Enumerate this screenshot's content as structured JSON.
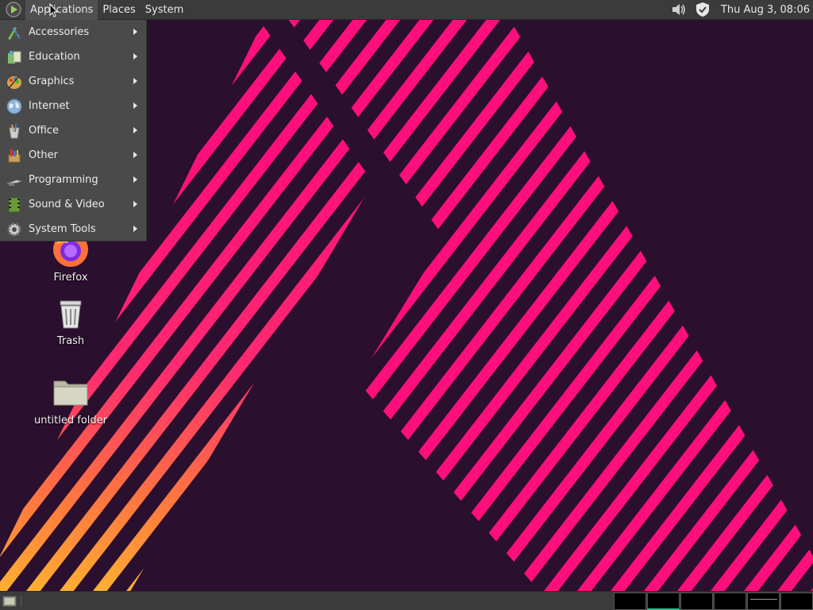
{
  "top_panel": {
    "menus": [
      "Applications",
      "Places",
      "System"
    ],
    "clock": "Thu Aug  3, 08:06",
    "tray": [
      "volume-icon",
      "shield-icon"
    ]
  },
  "app_menu": {
    "items": [
      {
        "label": "Accessories",
        "icon": "accessories-icon"
      },
      {
        "label": "Education",
        "icon": "education-icon"
      },
      {
        "label": "Graphics",
        "icon": "graphics-icon"
      },
      {
        "label": "Internet",
        "icon": "internet-icon"
      },
      {
        "label": "Office",
        "icon": "office-icon"
      },
      {
        "label": "Other",
        "icon": "other-icon"
      },
      {
        "label": "Programming",
        "icon": "programming-icon"
      },
      {
        "label": "Sound & Video",
        "icon": "sound-video-icon"
      },
      {
        "label": "System Tools",
        "icon": "system-tools-icon"
      }
    ]
  },
  "desktop_icons": [
    {
      "label": "Firefox",
      "icon": "firefox-icon"
    },
    {
      "label": "Trash",
      "icon": "trash-icon"
    },
    {
      "label": "untitled folder",
      "icon": "folder-icon"
    }
  ],
  "bottom_panel": {
    "workspaces": 6,
    "active_workspace": 2
  },
  "colors": {
    "wallpaper_bg": "#2a0f2e",
    "stripe_pink": "#ff0f7b",
    "stripe_orange": "#ff7a3d",
    "stripe_yellow": "#ffc12e",
    "panel": "#3b3b3b",
    "menu": "#4a4a4a",
    "workspace_accent": "#2dbd8c"
  }
}
